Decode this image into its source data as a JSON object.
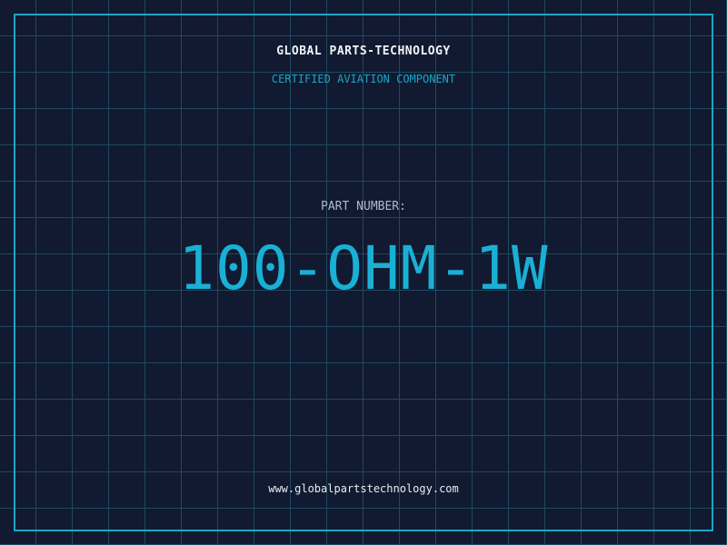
{
  "header": {
    "company": "GLOBAL PARTS-TECHNOLOGY",
    "subtitle": "CERTIFIED AVIATION COMPONENT"
  },
  "part": {
    "label": "PART NUMBER:",
    "number": "100-OHM-1W"
  },
  "footer": {
    "website": "www.globalpartstechnology.com"
  },
  "colors": {
    "background": "#111a30",
    "grid": "#1d4a60",
    "accent": "#1aa6c8",
    "text": "#f1f4f8"
  }
}
